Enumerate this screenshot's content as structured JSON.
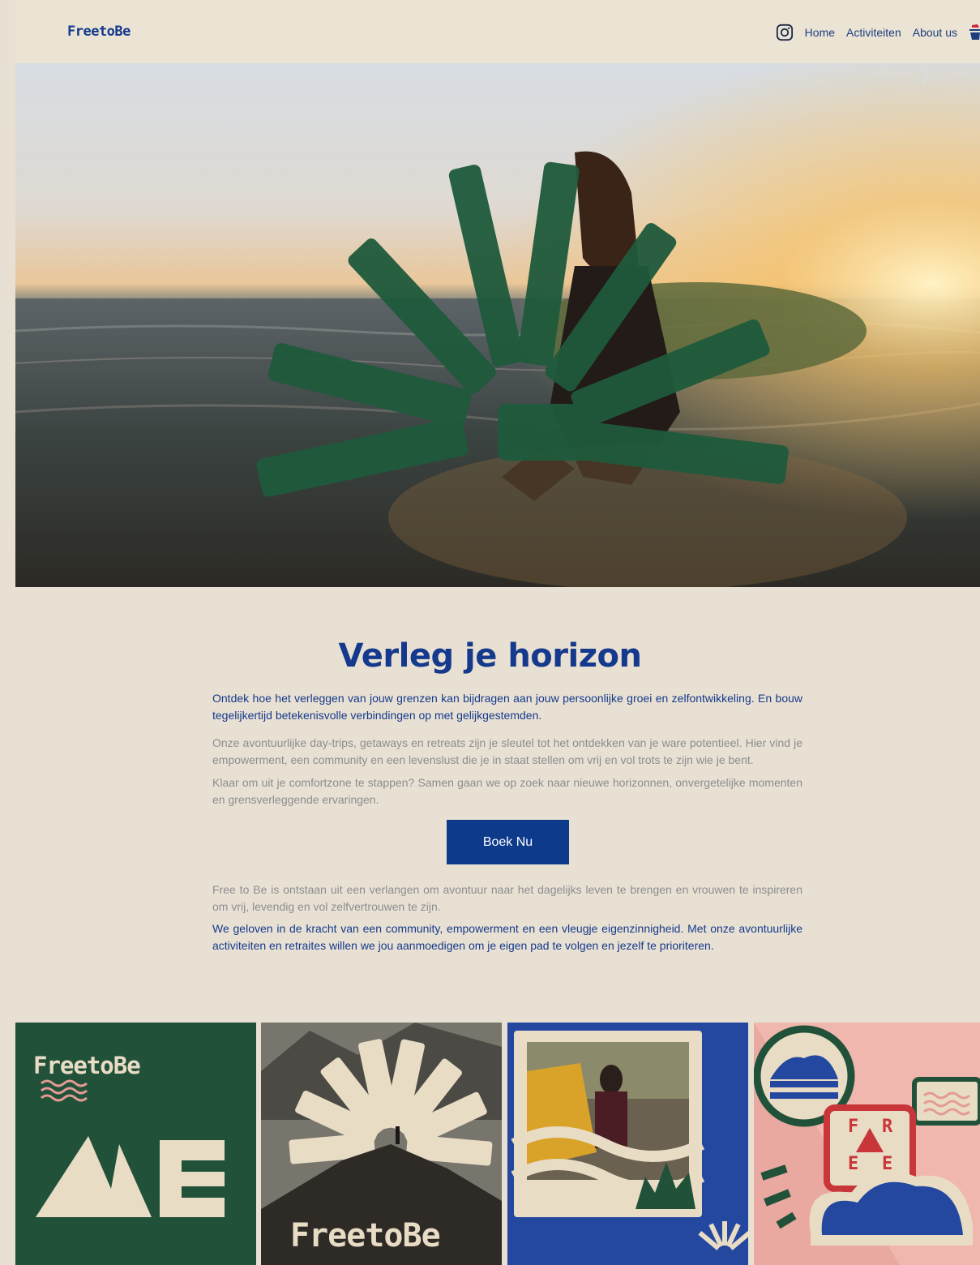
{
  "header": {
    "logo": "FreetoBe",
    "nav": [
      "Home",
      "Activiteiten",
      "About us"
    ]
  },
  "icons": {
    "instagram": "instagram-icon",
    "cart": "cart-icon",
    "prev": "chevron-left-icon",
    "next": "chevron-right-icon"
  },
  "colors": {
    "background": "#e8e1d3",
    "brand_blue": "#0e3a8c",
    "brand_green": "#1f5a3c",
    "pink": "#e8a59b"
  },
  "intro": {
    "title": "Verleg je horizon",
    "p1": "Ontdek hoe het verleggen van jouw grenzen kan bijdragen aan jouw persoonlijke groei en zelfontwikkeling. En bouw tegelijkertijd betekenisvolle verbindingen op met gelijkgestemden.",
    "p2": "Onze avontuurlijke day-trips, getaways en retreats zijn je sleutel tot het ontdekken van je ware potentieel. Hier vind je empowerment, een community en een levenslust die je in staat stellen om vrij en vol trots te zijn wie je bent.",
    "p3": "Klaar om uit je comfortzone te stappen? Samen gaan we op zoek naar nieuwe horizonnen, onvergetelijke momenten en grensverleggende ervaringen.",
    "cta": "Boek Nu",
    "p4": "Free to Be is ontstaan uit een verlangen om avontuur naar het dagelijks leven te brengen en vrouwen te inspireren om vrij, levendig en vol zelfvertrouwen te zijn.",
    "p5": "We geloven in de kracht van een community, empowerment en een vleugje eigenzinnigheid. Met onze avontuurlijke activiteiten en retraites willen we jou aanmoedigen om je eigen pad te volgen en jezelf te prioriteren."
  },
  "gallery": {
    "tile1_logo": "FreetoBe",
    "tile2_logo": "FreetoBe",
    "tile4_letters": [
      "F",
      "R",
      "E",
      "E"
    ]
  }
}
